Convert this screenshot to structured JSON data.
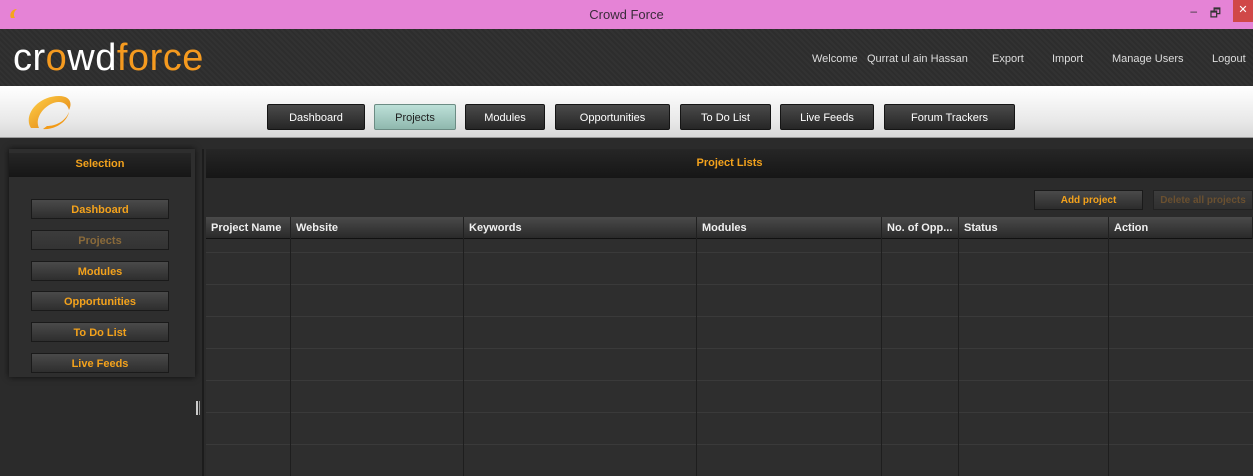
{
  "window": {
    "title": "Crowd Force",
    "minimize": "–",
    "restore": "🗗",
    "close": "✕"
  },
  "brand": {
    "logo_part1": "cr",
    "logo_o": "o",
    "logo_part2": "wd",
    "logo_part3": "force",
    "welcome": "Welcome",
    "user_name": "Qurrat ul ain Hassan",
    "export": "Export",
    "import": "Import",
    "manage_users": "Manage Users",
    "logout": "Logout",
    "accent_color": "#f3a21c"
  },
  "nav": {
    "items": [
      {
        "label": "Dashboard"
      },
      {
        "label": "Projects"
      },
      {
        "label": "Modules"
      },
      {
        "label": "Opportunities"
      },
      {
        "label": "To Do List"
      },
      {
        "label": "Live Feeds"
      },
      {
        "label": "Forum Trackers"
      }
    ],
    "active": "Projects"
  },
  "sidebar": {
    "title": "Selection",
    "items": [
      {
        "label": "Dashboard",
        "enabled": true
      },
      {
        "label": "Projects",
        "enabled": false
      },
      {
        "label": "Modules",
        "enabled": true
      },
      {
        "label": "Opportunities",
        "enabled": true
      },
      {
        "label": "To Do List",
        "enabled": true
      },
      {
        "label": "Live Feeds",
        "enabled": true
      }
    ]
  },
  "main": {
    "title": "Project Lists",
    "add_button": "Add project",
    "delete_button": "Delete all projects",
    "columns": [
      "Project Name",
      "Website",
      "Keywords",
      "Modules",
      "No. of Opp...",
      "Status",
      "Action"
    ],
    "rows": []
  }
}
